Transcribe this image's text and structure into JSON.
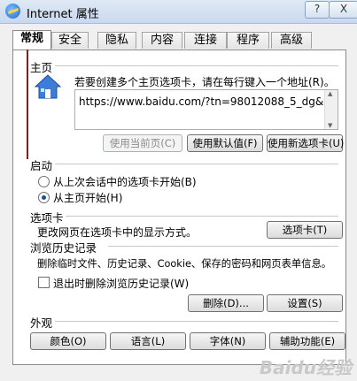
{
  "window": {
    "title": "Internet 属性",
    "help_label": "?",
    "close_label": "X"
  },
  "tabs": [
    {
      "label": "常规",
      "active": true
    },
    {
      "label": "安全"
    },
    {
      "label": "隐私"
    },
    {
      "label": "内容"
    },
    {
      "label": "连接"
    },
    {
      "label": "程序"
    },
    {
      "label": "高级"
    }
  ],
  "home": {
    "group_label": "主页",
    "description": "若要创建多个主页选项卡，请在每行键入一个地址(R)。",
    "url": "https://www.baidu.com/?tn=98012088_5_dg&cl",
    "use_current_label": "使用当前页(C)",
    "use_default_label": "使用默认值(F)",
    "use_new_tab_label": "使用新选项卡(U)"
  },
  "startup": {
    "group_label": "启动",
    "option_last_session": "从上次会话中的选项卡开始(B)",
    "option_home": "从主页开始(H)",
    "selected": "home"
  },
  "tabs_section": {
    "group_label": "选项卡",
    "description": "更改网页在选项卡中的显示方式。",
    "button_label": "选项卡(T)"
  },
  "history": {
    "group_label": "浏览历史记录",
    "description": "删除临时文件、历史记录、Cookie、保存的密码和网页表单信息。",
    "checkbox_label": "退出时删除浏览历史记录(W)",
    "checkbox_checked": false,
    "delete_label": "删除(D)...",
    "settings_label": "设置(S)"
  },
  "appearance": {
    "group_label": "外观",
    "colors_label": "颜色(O)",
    "languages_label": "语言(L)",
    "fonts_label": "字体(N)",
    "accessibility_label": "辅助功能(E)"
  },
  "watermark": "Baidu经验",
  "annotation": {
    "arrow_color": "#8b1a1a"
  }
}
